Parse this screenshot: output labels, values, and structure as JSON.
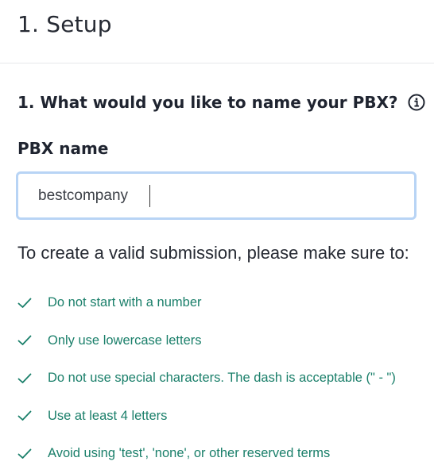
{
  "header": {
    "title": "1. Setup"
  },
  "question": {
    "text": "1. What would you like to name your PBX?",
    "info_icon": "info-circle-icon"
  },
  "field": {
    "label": "PBX name",
    "value": "bestcompany"
  },
  "rules": {
    "heading": "To create a valid submission, please make sure to:",
    "icon": "check-icon",
    "accent_color": "#1a7f6a",
    "items": [
      "Do not start with a number",
      "Only use lowercase letters",
      "Do not use special characters. The dash is acceptable (\" - \")",
      "Use at least 4 letters",
      "Avoid using 'test', 'none', or other reserved terms"
    ]
  }
}
